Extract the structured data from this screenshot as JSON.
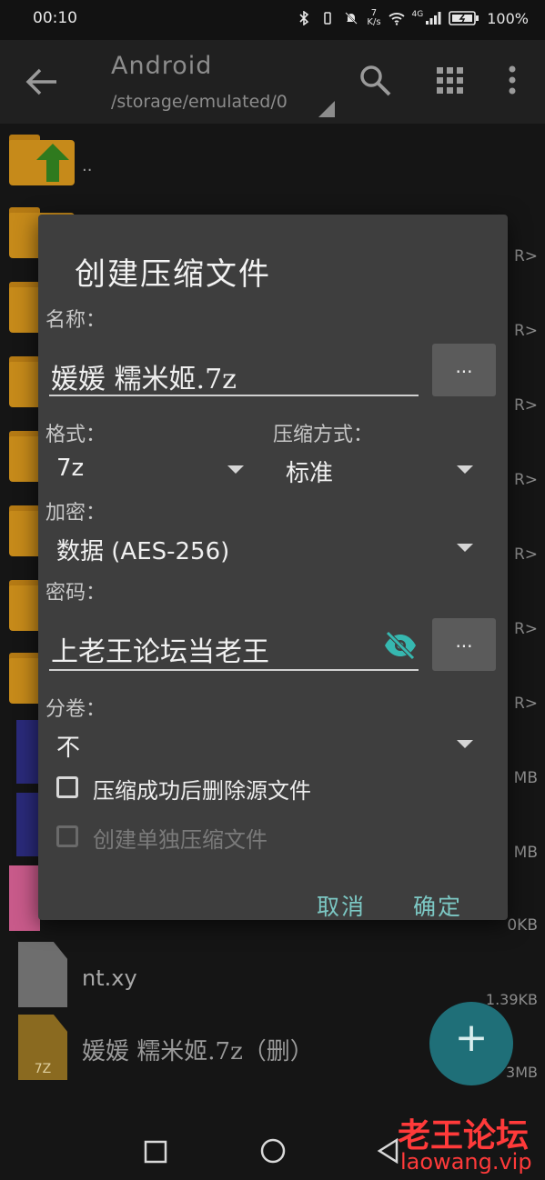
{
  "status_bar": {
    "time": "00:10",
    "net_speed_top": "7",
    "net_speed_bottom": "K/s",
    "network": "4G",
    "battery": "100%"
  },
  "toolbar": {
    "title": "Android",
    "path": "/storage/emulated/0"
  },
  "file_list": {
    "parent_label": "..",
    "rows": [
      {
        "right": "R>"
      },
      {
        "right": "R>"
      },
      {
        "right": "R>"
      },
      {
        "right": "R>"
      },
      {
        "right": "R>"
      },
      {
        "right": "R>"
      },
      {
        "right": "R>"
      },
      {
        "right": "MB"
      },
      {
        "right": "MB"
      },
      {
        "right": "0KB"
      }
    ],
    "file_nt": "nt.xy",
    "file_nt_size": "1.39KB",
    "file_7z": "媛媛 糯米姬.7z（删）",
    "file_7z_size": "3MB",
    "file_7z_icon_label": "7Z"
  },
  "dialog": {
    "title": "创建压缩文件",
    "name_label": "名称：",
    "name_value": "媛媛 糯米姬.7z",
    "browse_button": "...",
    "format_label": "格式：",
    "format_value": "7z",
    "method_label": "压缩方式：",
    "method_value": "标准",
    "encryption_label": "加密：",
    "encryption_value": "数据 (AES-256)",
    "password_label": "密码：",
    "password_value": "上老王论坛当老王",
    "password_button": "...",
    "split_label": "分卷：",
    "split_value": "不",
    "delete_after_label": "压缩成功后删除源文件",
    "separate_archive_label": "创建单独压缩文件",
    "cancel": "取消",
    "ok": "确定"
  },
  "fab": {
    "label": "+"
  },
  "watermark": {
    "line1": "老王论坛",
    "line2": "laowang.vip"
  },
  "colors": {
    "accent": "#7cc8c4",
    "fab": "#1f6f78",
    "folder": "#c68a1a",
    "dialog_bg": "#3e3e3e"
  }
}
